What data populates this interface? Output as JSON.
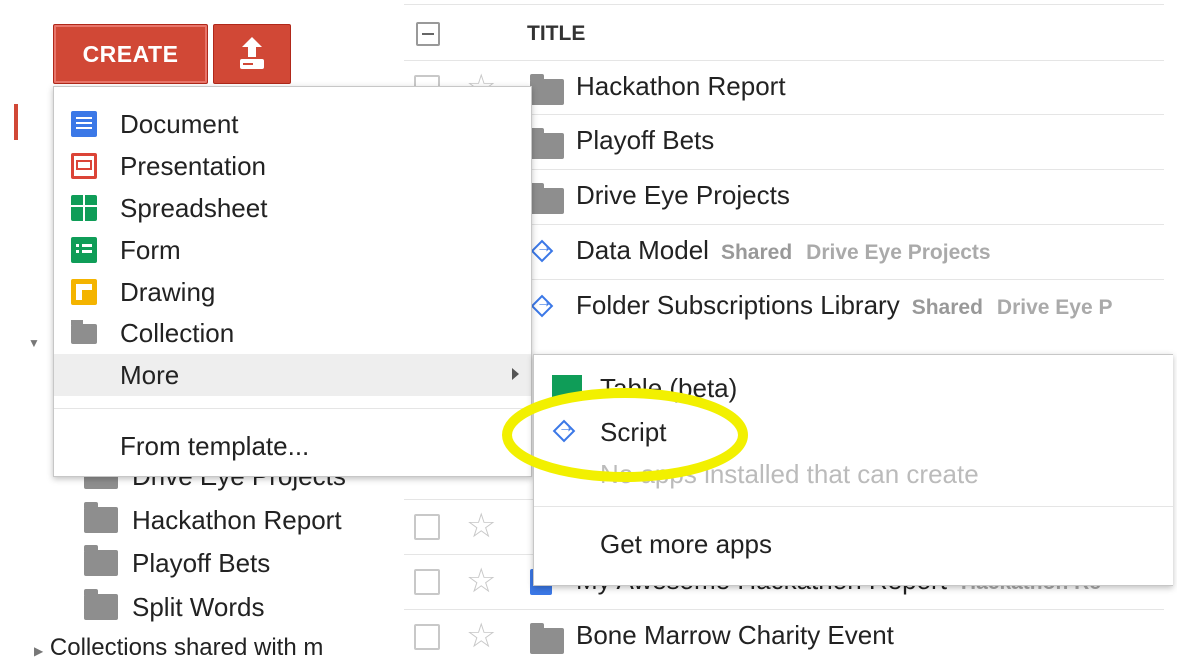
{
  "toolbar": {
    "create_label": "CREATE",
    "upload_icon": "upload-icon"
  },
  "list": {
    "header_title": "TITLE",
    "rows": [
      {
        "title": "Hackathon Report",
        "icon": "folder-icon",
        "shared": "",
        "folder": ""
      },
      {
        "title": "Playoff Bets",
        "icon": "folder-icon",
        "shared": "",
        "folder": ""
      },
      {
        "title": "Drive Eye Projects",
        "icon": "folder-icon",
        "shared": "",
        "folder": ""
      },
      {
        "title": "Data Model",
        "icon": "script-icon",
        "shared": "Shared",
        "folder": "Drive Eye Projects"
      },
      {
        "title": "Folder Subscriptions Library",
        "icon": "script-icon",
        "shared": "Shared",
        "folder": "Drive Eye P"
      },
      {
        "title": "My Awesome Hackathon Report",
        "icon": "document-icon",
        "shared": "",
        "folder": "Hackathon Re"
      },
      {
        "title": "Bone Marrow Charity Event",
        "icon": "folder-icon",
        "shared": "",
        "folder": ""
      }
    ]
  },
  "create_menu": {
    "items": [
      {
        "label": "Document",
        "icon": "document-icon"
      },
      {
        "label": "Presentation",
        "icon": "presentation-icon"
      },
      {
        "label": "Spreadsheet",
        "icon": "spreadsheet-icon"
      },
      {
        "label": "Form",
        "icon": "form-icon"
      },
      {
        "label": "Drawing",
        "icon": "drawing-icon"
      },
      {
        "label": "Collection",
        "icon": "folder-icon"
      },
      {
        "label": "More",
        "icon": ""
      }
    ],
    "from_template": "From template..."
  },
  "more_submenu": {
    "items": [
      {
        "label": "Table (beta)",
        "icon": "table-icon"
      },
      {
        "label": "Script",
        "icon": "script-icon"
      }
    ],
    "disabled_note": "No apps installed that can create",
    "get_more_apps": "Get more apps"
  },
  "sidebar": {
    "tree": [
      {
        "label": "Drive Eye Projects"
      },
      {
        "label": "Hackathon Report"
      },
      {
        "label": "Playoff Bets"
      },
      {
        "label": "Split Words"
      }
    ],
    "collections_shared": "Collections shared with m"
  },
  "colors": {
    "create_red": "#d14836",
    "highlight_yellow": "#f2f000",
    "link_blue": "#3b78e7"
  }
}
